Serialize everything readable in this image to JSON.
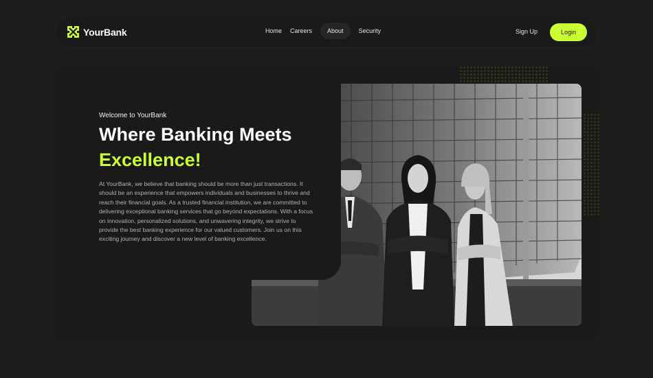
{
  "brand": {
    "name": "YourBank",
    "accent_color": "#caff33"
  },
  "nav": {
    "items": [
      {
        "label": "Home",
        "active": false
      },
      {
        "label": "Careers",
        "active": false
      },
      {
        "label": "About",
        "active": true
      },
      {
        "label": "Security",
        "active": false
      }
    ],
    "signup_label": "Sign Up",
    "login_label": "Login"
  },
  "hero": {
    "welcome": "Welcome to YourBank",
    "headline": "Where Banking Meets",
    "headline_accent": "Excellence!",
    "description": "At YourBank, we believe that banking should be more than just transactions. It should be an experience that empowers individuals and businesses to thrive and reach their financial goals. As a trusted financial institution, we are committed to delivering exceptional banking services that go beyond expectations. With a focus on innovation, personalized solutions, and unwavering integrity, we strive to provide the best banking experience for our valued customers. Join us on this exciting journey and discover a new level of banking excellence.",
    "image": {
      "icon": "team-photo",
      "style": "black-and-white"
    }
  }
}
